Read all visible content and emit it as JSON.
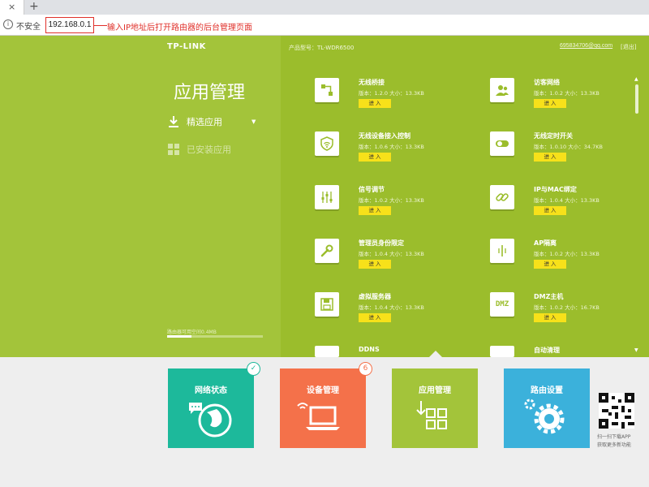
{
  "browser": {
    "tab_close": "×",
    "new_tab": "+",
    "info_icon": "i",
    "insecure_label": "不安全",
    "url": "192.168.0.1",
    "annotation": "输入IP地址后打开路由器的后台管理页面"
  },
  "header": {
    "logo": "TP-LINK",
    "model": "产品型号：TL-WDR6500",
    "account": "695834706@qq.com",
    "logout": "[退出]"
  },
  "sidebar": {
    "title": "应用管理",
    "items": [
      {
        "label": "精选应用"
      },
      {
        "label": "已安装应用"
      }
    ],
    "storage_label": "路由器可用空间0.4MB",
    "storage_fraction": 0.25
  },
  "apps": {
    "enter_label": "进 入",
    "items": [
      {
        "name": "无线桥接",
        "meta": "版本：1.2.0  大小：13.3KB",
        "icon": "bridge-icon"
      },
      {
        "name": "访客网络",
        "meta": "版本：1.0.2  大小：13.3KB",
        "icon": "guest-network-icon"
      },
      {
        "name": "无线设备接入控制",
        "meta": "版本：1.0.6  大小：13.3KB",
        "icon": "wifi-shield-icon"
      },
      {
        "name": "无线定时开关",
        "meta": "版本：1.0.10  大小：34.7KB",
        "icon": "toggle-switch-icon"
      },
      {
        "name": "信号调节",
        "meta": "版本：1.0.2  大小：13.3KB",
        "icon": "equalizer-icon"
      },
      {
        "name": "IP与MAC绑定",
        "meta": "版本：1.0.4  大小：13.3KB",
        "icon": "link-icon"
      },
      {
        "name": "管理员身份限定",
        "meta": "版本：1.0.4  大小：13.3KB",
        "icon": "wrench-icon"
      },
      {
        "name": "AP隔离",
        "meta": "版本：1.0.2  大小：13.3KB",
        "icon": "ap-isolate-icon"
      },
      {
        "name": "虚拟服务器",
        "meta": "版本：1.0.4  大小：13.3KB",
        "icon": "floppy-icon"
      },
      {
        "name": "DMZ主机",
        "meta": "版本：1.0.2  大小：16.7KB",
        "icon": "dmz-icon"
      },
      {
        "name": "DDNS",
        "meta": "",
        "icon": "ddns-icon"
      },
      {
        "name": "自动清理",
        "meta": "",
        "icon": "auto-clean-icon"
      }
    ],
    "dmz_text": "DMZ"
  },
  "tiles": [
    {
      "label": "网络状态",
      "color": "#1db99b",
      "badge": "✓"
    },
    {
      "label": "设备管理",
      "color": "#f4714a",
      "badge": "6"
    },
    {
      "label": "应用管理",
      "color": "#a3c43a"
    },
    {
      "label": "路由设置",
      "color": "#3bb1db"
    }
  ],
  "qr": {
    "caption1": "扫一扫下载APP",
    "caption2": "获取更多新功能"
  },
  "scroll": {
    "up": "▲",
    "down": "▼"
  },
  "colors": {
    "accent_green": "#a3c43a",
    "button_yellow": "#f7e11a",
    "alert_red": "#e0302a"
  }
}
